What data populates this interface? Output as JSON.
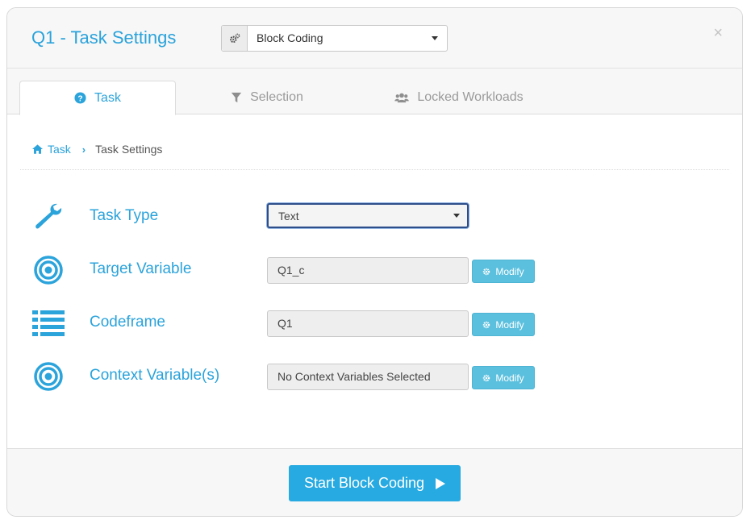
{
  "header": {
    "title": "Q1 - Task Settings",
    "mode_select_value": "Block Coding",
    "close_symbol": "×"
  },
  "tabs": [
    {
      "label": "Task",
      "icon": "question-circle-icon",
      "active": true
    },
    {
      "label": "Selection",
      "icon": "filter-icon",
      "active": false
    },
    {
      "label": "Locked Workloads",
      "icon": "users-icon",
      "active": false
    }
  ],
  "breadcrumb": {
    "home_label": "Task",
    "current_label": "Task Settings"
  },
  "settings": {
    "task_type": {
      "label": "Task Type",
      "value": "Text",
      "icon": "wrench-icon"
    },
    "target_variable": {
      "label": "Target Variable",
      "value": "Q1_c",
      "icon": "bullseye-icon",
      "button": "Modify"
    },
    "codeframe": {
      "label": "Codeframe",
      "value": "Q1",
      "icon": "list-icon",
      "button": "Modify"
    },
    "context_variables": {
      "label": "Context Variable(s)",
      "value": "No Context Variables Selected",
      "icon": "bullseye-icon",
      "button": "Modify"
    }
  },
  "footer": {
    "start_label": "Start Block Coding"
  },
  "colors": {
    "accent": "#2ba3db",
    "modify_button": "#5bc0de",
    "start_button": "#27aae1"
  }
}
